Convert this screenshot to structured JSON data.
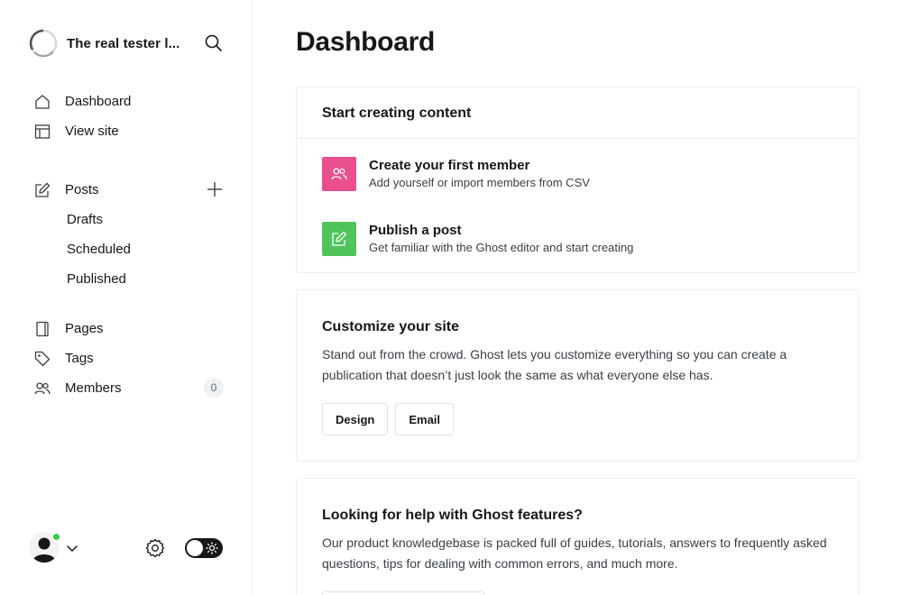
{
  "site": {
    "title": "The real tester l..."
  },
  "nav": {
    "dashboard": "Dashboard",
    "view_site": "View site",
    "posts": "Posts",
    "drafts": "Drafts",
    "scheduled": "Scheduled",
    "published": "Published",
    "pages": "Pages",
    "tags": "Tags",
    "members": "Members",
    "members_count": "0"
  },
  "main": {
    "title": "Dashboard",
    "start_card": {
      "title": "Start creating content",
      "tasks": [
        {
          "title": "Create your first member",
          "desc": "Add yourself or import members from CSV",
          "icon": "members-icon",
          "color": "#e94f8c"
        },
        {
          "title": "Publish a post",
          "desc": "Get familiar with the Ghost editor and start creating",
          "icon": "edit-icon",
          "color": "#4fc45a"
        }
      ]
    },
    "customize_card": {
      "title": "Customize your site",
      "text": "Stand out from the crowd. Ghost lets you customize everything so you can create a publication that doesn’t just look the same as what everyone else has.",
      "buttons": [
        "Design",
        "Email"
      ]
    },
    "help_card": {
      "title": "Looking for help with Ghost features?",
      "text": "Our product knowledgebase is packed full of guides, tutorials, answers to frequently asked questions, tips for dealing with common errors, and much more."
    }
  },
  "colors": {
    "online": "#30cf43",
    "toggle_bg": "#15171a"
  }
}
